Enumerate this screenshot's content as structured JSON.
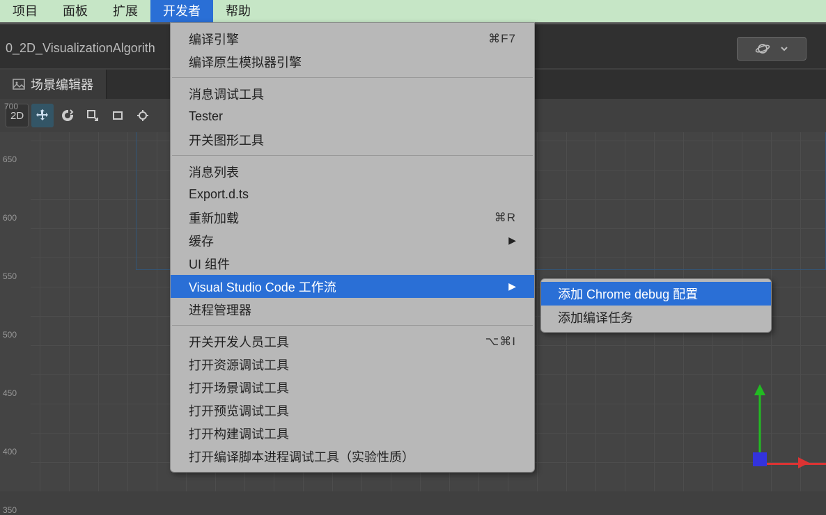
{
  "menubar": {
    "items": [
      "项目",
      "面板",
      "扩展",
      "开发者",
      "帮助"
    ],
    "activeIndex": 3
  },
  "tabbar": {
    "projectName": "0_2D_VisualizationAlgorith"
  },
  "sceneTab": {
    "label": "场景编辑器"
  },
  "toolbar": {
    "mode2d": "2D"
  },
  "ruler": {
    "top": "700",
    "ticks": [
      "650",
      "600",
      "550",
      "500",
      "450",
      "400",
      "350"
    ]
  },
  "devMenu": {
    "groups": [
      [
        {
          "label": "编译引擎",
          "shortcut": "⌘F7"
        },
        {
          "label": "编译原生模拟器引擎"
        }
      ],
      [
        {
          "label": "消息调试工具"
        },
        {
          "label": "Tester"
        },
        {
          "label": "开关图形工具"
        }
      ],
      [
        {
          "label": "消息列表"
        },
        {
          "label": "Export.d.ts"
        },
        {
          "label": "重新加载",
          "shortcut": "⌘R"
        },
        {
          "label": "缓存",
          "submenu": true
        },
        {
          "label": "UI 组件"
        },
        {
          "label": "Visual Studio Code 工作流",
          "submenu": true,
          "highlight": true
        },
        {
          "label": "进程管理器"
        }
      ],
      [
        {
          "label": "开关开发人员工具",
          "shortcut": "⌥⌘I"
        },
        {
          "label": "打开资源调试工具"
        },
        {
          "label": "打开场景调试工具"
        },
        {
          "label": "打开预览调试工具"
        },
        {
          "label": "打开构建调试工具"
        },
        {
          "label": "打开编译脚本进程调试工具（实验性质）"
        }
      ]
    ]
  },
  "submenu": {
    "items": [
      {
        "label": "添加 Chrome debug 配置",
        "highlight": true
      },
      {
        "label": "添加编译任务"
      }
    ]
  }
}
